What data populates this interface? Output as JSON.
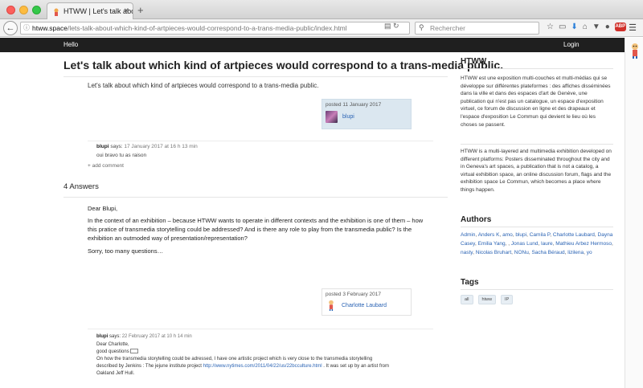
{
  "browser": {
    "tab_title": "HTWW | Let's talk about w...",
    "tab_close": "×",
    "new_tab": "+",
    "url_host": "htww.space",
    "url_path": "/lets-talk-about-which-kind-of-artpieces-would-correspond-to-a-trans-media-public/index.html",
    "search_placeholder": "Rechercher"
  },
  "site": {
    "hello": "Hello",
    "login": "Login"
  },
  "question": {
    "title": "Let's talk about which kind of artpieces would correspond to a trans-media public.",
    "body": "Let's talk about which kind of artpieces would correspond to a trans-media public.",
    "posted": "posted 11 January 2017",
    "author": "blupi",
    "comment": {
      "author": "blupi",
      "says": "says:",
      "date": "17 January 2017 at 16 h 13 min",
      "text": "oui bravo tu as raison"
    },
    "add_comment": "+ add comment"
  },
  "answers": {
    "count_label": "4 Answers",
    "first": {
      "greeting": "Dear Blupi,",
      "paragraph": "In the context of an exhibition – because HTWW wants to operate in different contexts and the exhibition is one of them – how this pratice of transmedia storytelling could be addressed? And is there any role to play from the transmedia public? Is the exhibition an outmoded way of presentation/representation?",
      "closing": "Sorry, too many questions…",
      "posted": "posted 3 February 2017",
      "author": "Charlotte Laubard",
      "comment": {
        "author": "blupi",
        "says": "says:",
        "date": "22 February 2017 at 10 h 14 min",
        "line1": "Dear Charlotte,",
        "line2": "good questions",
        "line3": "On how the transmedia storytelling could be adressed, I have one artistic project which is very close to the transmedia storytelling",
        "line4_pre": "described by Jenkins : The jejune institute project ",
        "line4_link": "http://www.nytimes.com/2011/04/22/us/22bcculture.html",
        "line4_post": " . It was set up by an artist from",
        "line5": "Oakland Jeff Hull."
      }
    }
  },
  "sidebar": {
    "heading": "HTWW",
    "fr_text": "HTWW est une exposition multi-couches et multi-médias qui se développe sur différentes plateformes : des affiches disséminées dans la ville et dans des espaces d'art de Genève, une publication qui n'est pas un catalogue, un espace d'exposition virtuel, ce forum de discussion en ligne et des drapeaux et l'espace d'exposition Le Commun qui devient le lieu où les choses se passent.",
    "en_text": "HTWW is a multi-layered and multimedia exhibition developed on different platforms: Posters disseminated throughout the city and in Geneva's art spaces, a publication that is not a catalog, a virtual exhibition space, an online discussion forum, flags and the exhibition space Le Commun, which becomes a place where things happen.",
    "authors_heading": "Authors",
    "authors": [
      "Admin",
      "Anders K",
      "amo",
      "blupi",
      "Camila P",
      "Charlotte Laubard",
      "Dayna Casey",
      "Emilia Yang",
      "",
      "Jonas Lund",
      "laure",
      "Mathieu Arbez Hermoso",
      "nasty",
      "Nicolas Bruhart",
      "NONu",
      "Sacha Béraud",
      "lizilena",
      "yo"
    ],
    "tags_heading": "Tags",
    "tags": [
      "all",
      "htww",
      "IP"
    ]
  },
  "colors": {
    "link": "#2a63b4",
    "header_bg": "#1f1f1f",
    "posted_bg": "#dbe7f0"
  }
}
